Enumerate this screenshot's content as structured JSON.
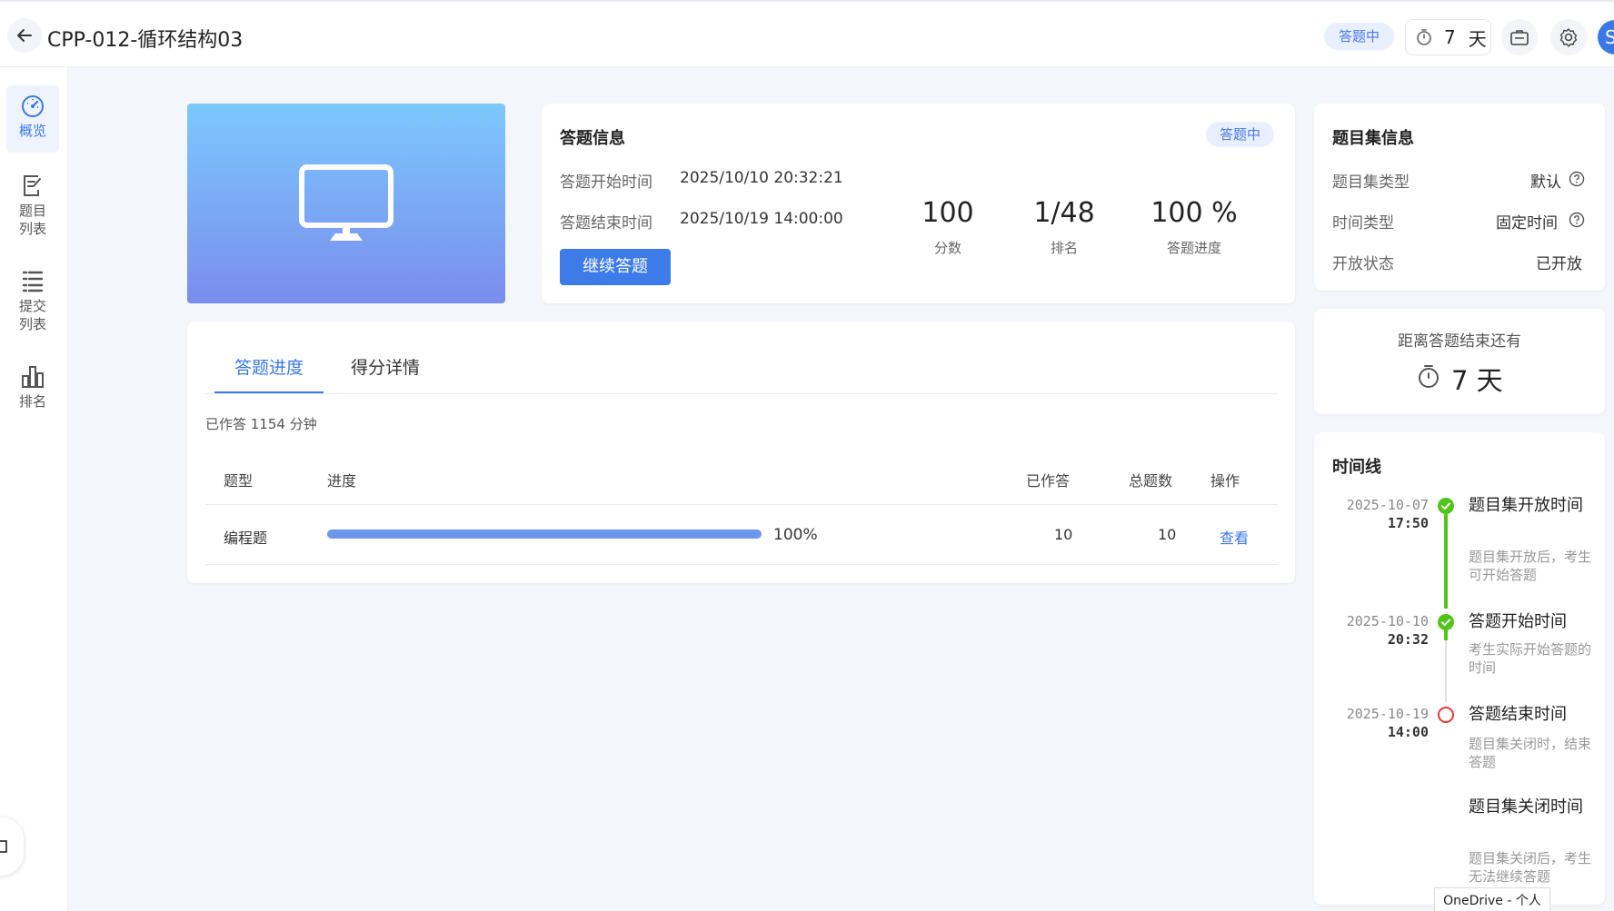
{
  "header": {
    "title": "CPP-012-循环结构03",
    "status": "答题中",
    "timer_value": "7",
    "timer_unit": "天",
    "avatar_letter": "S"
  },
  "sidebar": {
    "items": [
      {
        "label": "概览"
      },
      {
        "label": "题目\n列表"
      },
      {
        "label": "提交\n列表"
      },
      {
        "label": "排名"
      }
    ]
  },
  "answer_info": {
    "title": "答题信息",
    "status": "答题中",
    "start_label": "答题开始时间",
    "start_value": "2025/10/10 20:32:21",
    "end_label": "答题结束时间",
    "end_value": "2025/10/19 14:00:00",
    "continue_button": "继续答题",
    "stats": [
      {
        "value": "100",
        "label": "分数"
      },
      {
        "value": "1/48",
        "label": "排名"
      },
      {
        "value": "100 %",
        "label": "答题进度"
      }
    ]
  },
  "tabs": [
    "答题进度",
    "得分详情"
  ],
  "progress": {
    "elapsed": "已作答 1154 分钟",
    "columns": [
      "题型",
      "进度",
      "已作答",
      "总题数",
      "操作"
    ],
    "rows": [
      {
        "type": "编程题",
        "percent_text": "100%",
        "progress": 1.0,
        "answered": "10",
        "total": "10",
        "action": "查看"
      }
    ]
  },
  "set_info": {
    "title": "题目集信息",
    "rows": [
      {
        "label": "题目集类型",
        "value": "默认"
      },
      {
        "label": "时间类型",
        "value": "固定时间"
      },
      {
        "label": "开放状态",
        "value": "已开放"
      }
    ]
  },
  "countdown": {
    "label": "距离答题结束还有",
    "value": "7 天"
  },
  "timeline": {
    "title": "时间线",
    "events": [
      {
        "date": "2025-10-07",
        "time": "17:50",
        "title": "题目集开放时间",
        "desc": "题目集开放后，考生可开始答题",
        "status": "done"
      },
      {
        "date": "2025-10-10",
        "time": "20:32",
        "title": "答题开始时间",
        "desc": "考生实际开始答题的时间",
        "status": "done"
      },
      {
        "date": "2025-10-19",
        "time": "14:00",
        "title": "答题结束时间",
        "desc": "题目集关闭时，结束答题",
        "status": "pending"
      },
      {
        "date": "",
        "time": "",
        "title": "题目集关闭时间",
        "desc": "题目集关闭后，考生无法继续答题",
        "status": "none"
      }
    ]
  },
  "overlay": {
    "onedrive": "OneDrive - 个人"
  },
  "colors": {
    "accent": "#3b78e7",
    "success": "#52c41a",
    "danger": "#e53935"
  }
}
